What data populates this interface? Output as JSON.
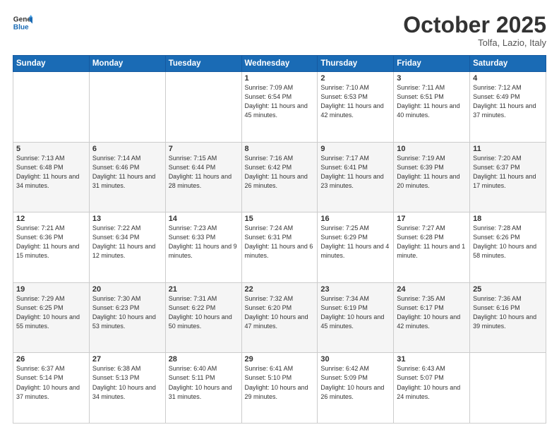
{
  "header": {
    "logo_line1": "General",
    "logo_line2": "Blue",
    "month": "October 2025",
    "location": "Tolfa, Lazio, Italy"
  },
  "weekdays": [
    "Sunday",
    "Monday",
    "Tuesday",
    "Wednesday",
    "Thursday",
    "Friday",
    "Saturday"
  ],
  "weeks": [
    [
      {
        "day": "",
        "info": ""
      },
      {
        "day": "",
        "info": ""
      },
      {
        "day": "",
        "info": ""
      },
      {
        "day": "1",
        "info": "Sunrise: 7:09 AM\nSunset: 6:54 PM\nDaylight: 11 hours\nand 45 minutes."
      },
      {
        "day": "2",
        "info": "Sunrise: 7:10 AM\nSunset: 6:53 PM\nDaylight: 11 hours\nand 42 minutes."
      },
      {
        "day": "3",
        "info": "Sunrise: 7:11 AM\nSunset: 6:51 PM\nDaylight: 11 hours\nand 40 minutes."
      },
      {
        "day": "4",
        "info": "Sunrise: 7:12 AM\nSunset: 6:49 PM\nDaylight: 11 hours\nand 37 minutes."
      }
    ],
    [
      {
        "day": "5",
        "info": "Sunrise: 7:13 AM\nSunset: 6:48 PM\nDaylight: 11 hours\nand 34 minutes."
      },
      {
        "day": "6",
        "info": "Sunrise: 7:14 AM\nSunset: 6:46 PM\nDaylight: 11 hours\nand 31 minutes."
      },
      {
        "day": "7",
        "info": "Sunrise: 7:15 AM\nSunset: 6:44 PM\nDaylight: 11 hours\nand 28 minutes."
      },
      {
        "day": "8",
        "info": "Sunrise: 7:16 AM\nSunset: 6:42 PM\nDaylight: 11 hours\nand 26 minutes."
      },
      {
        "day": "9",
        "info": "Sunrise: 7:17 AM\nSunset: 6:41 PM\nDaylight: 11 hours\nand 23 minutes."
      },
      {
        "day": "10",
        "info": "Sunrise: 7:19 AM\nSunset: 6:39 PM\nDaylight: 11 hours\nand 20 minutes."
      },
      {
        "day": "11",
        "info": "Sunrise: 7:20 AM\nSunset: 6:37 PM\nDaylight: 11 hours\nand 17 minutes."
      }
    ],
    [
      {
        "day": "12",
        "info": "Sunrise: 7:21 AM\nSunset: 6:36 PM\nDaylight: 11 hours\nand 15 minutes."
      },
      {
        "day": "13",
        "info": "Sunrise: 7:22 AM\nSunset: 6:34 PM\nDaylight: 11 hours\nand 12 minutes."
      },
      {
        "day": "14",
        "info": "Sunrise: 7:23 AM\nSunset: 6:33 PM\nDaylight: 11 hours\nand 9 minutes."
      },
      {
        "day": "15",
        "info": "Sunrise: 7:24 AM\nSunset: 6:31 PM\nDaylight: 11 hours\nand 6 minutes."
      },
      {
        "day": "16",
        "info": "Sunrise: 7:25 AM\nSunset: 6:29 PM\nDaylight: 11 hours\nand 4 minutes."
      },
      {
        "day": "17",
        "info": "Sunrise: 7:27 AM\nSunset: 6:28 PM\nDaylight: 11 hours\nand 1 minute."
      },
      {
        "day": "18",
        "info": "Sunrise: 7:28 AM\nSunset: 6:26 PM\nDaylight: 10 hours\nand 58 minutes."
      }
    ],
    [
      {
        "day": "19",
        "info": "Sunrise: 7:29 AM\nSunset: 6:25 PM\nDaylight: 10 hours\nand 55 minutes."
      },
      {
        "day": "20",
        "info": "Sunrise: 7:30 AM\nSunset: 6:23 PM\nDaylight: 10 hours\nand 53 minutes."
      },
      {
        "day": "21",
        "info": "Sunrise: 7:31 AM\nSunset: 6:22 PM\nDaylight: 10 hours\nand 50 minutes."
      },
      {
        "day": "22",
        "info": "Sunrise: 7:32 AM\nSunset: 6:20 PM\nDaylight: 10 hours\nand 47 minutes."
      },
      {
        "day": "23",
        "info": "Sunrise: 7:34 AM\nSunset: 6:19 PM\nDaylight: 10 hours\nand 45 minutes."
      },
      {
        "day": "24",
        "info": "Sunrise: 7:35 AM\nSunset: 6:17 PM\nDaylight: 10 hours\nand 42 minutes."
      },
      {
        "day": "25",
        "info": "Sunrise: 7:36 AM\nSunset: 6:16 PM\nDaylight: 10 hours\nand 39 minutes."
      }
    ],
    [
      {
        "day": "26",
        "info": "Sunrise: 6:37 AM\nSunset: 5:14 PM\nDaylight: 10 hours\nand 37 minutes."
      },
      {
        "day": "27",
        "info": "Sunrise: 6:38 AM\nSunset: 5:13 PM\nDaylight: 10 hours\nand 34 minutes."
      },
      {
        "day": "28",
        "info": "Sunrise: 6:40 AM\nSunset: 5:11 PM\nDaylight: 10 hours\nand 31 minutes."
      },
      {
        "day": "29",
        "info": "Sunrise: 6:41 AM\nSunset: 5:10 PM\nDaylight: 10 hours\nand 29 minutes."
      },
      {
        "day": "30",
        "info": "Sunrise: 6:42 AM\nSunset: 5:09 PM\nDaylight: 10 hours\nand 26 minutes."
      },
      {
        "day": "31",
        "info": "Sunrise: 6:43 AM\nSunset: 5:07 PM\nDaylight: 10 hours\nand 24 minutes."
      },
      {
        "day": "",
        "info": ""
      }
    ]
  ]
}
